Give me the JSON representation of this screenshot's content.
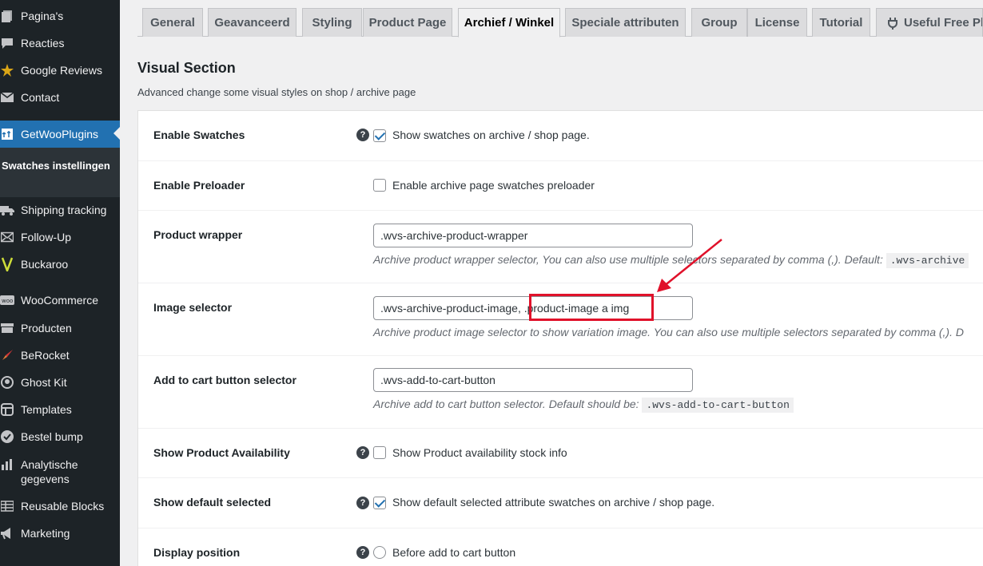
{
  "sidebar": {
    "items": [
      {
        "label": "Pagina's",
        "icon": "pages-icon"
      },
      {
        "label": "Reacties",
        "icon": "comments-icon"
      },
      {
        "label": "Google Reviews",
        "icon": "star-icon"
      },
      {
        "label": "Contact",
        "icon": "mail-icon"
      },
      {
        "label": "GetWooPlugins",
        "icon": "plugin-icon"
      },
      {
        "label": "Shipping tracking",
        "icon": "truck-icon"
      },
      {
        "label": "Follow-Up",
        "icon": "envelope-icon"
      },
      {
        "label": "Buckaroo",
        "icon": "buckaroo-icon"
      },
      {
        "label": "WooCommerce",
        "icon": "woo-icon"
      },
      {
        "label": "Producten",
        "icon": "products-icon"
      },
      {
        "label": "BeRocket",
        "icon": "rocket-icon"
      },
      {
        "label": "Ghost Kit",
        "icon": "ghost-icon"
      },
      {
        "label": "Templates",
        "icon": "templates-icon"
      },
      {
        "label": "Bestel bump",
        "icon": "check-circle-icon"
      },
      {
        "label": "Analytische gegevens",
        "icon": "chart-icon"
      },
      {
        "label": "Reusable Blocks",
        "icon": "blocks-icon"
      },
      {
        "label": "Marketing",
        "icon": "megaphone-icon"
      }
    ],
    "submenu_label": "Swatches instellingen"
  },
  "tabs": [
    {
      "label": "General"
    },
    {
      "label": "Geavanceerd"
    },
    {
      "label": "Styling"
    },
    {
      "label": "Product Page"
    },
    {
      "label": "Archief / Winkel"
    },
    {
      "label": "Speciale attributen"
    },
    {
      "label": "Group"
    },
    {
      "label": "License"
    },
    {
      "label": "Tutorial"
    },
    {
      "label": "Useful Free Plu"
    }
  ],
  "section": {
    "title": "Visual Section",
    "description": "Advanced change some visual styles on shop / archive page"
  },
  "rows": {
    "enable_swatches": {
      "label": "Enable Swatches",
      "text": "Show swatches on archive / shop page."
    },
    "enable_preloader": {
      "label": "Enable Preloader",
      "text": "Enable archive page swatches preloader"
    },
    "product_wrapper": {
      "label": "Product wrapper",
      "value": ".wvs-archive-product-wrapper",
      "desc": "Archive product wrapper selector, You can also use multiple selectors separated by comma (,). Default:",
      "code": ".wvs-archive"
    },
    "image_selector": {
      "label": "Image selector",
      "value": ".wvs-archive-product-image, .product-image a img",
      "desc": "Archive product image selector to show variation image. You can also use multiple selectors separated by comma (,). D"
    },
    "add_to_cart": {
      "label": "Add to cart button selector",
      "value": ".wvs-add-to-cart-button",
      "desc": "Archive add to cart button selector. Default should be:",
      "code": ".wvs-add-to-cart-button"
    },
    "availability": {
      "label": "Show Product Availability",
      "text": "Show Product availability stock info"
    },
    "default_selected": {
      "label": "Show default selected",
      "text": "Show default selected attribute swatches on archive / shop page."
    },
    "display_position": {
      "label": "Display position",
      "text": "Before add to cart button"
    }
  },
  "help_glyph": "?",
  "colors": {
    "accent": "#2271b1",
    "annotation": "#e0112a",
    "sidebar": "#1d2327"
  }
}
